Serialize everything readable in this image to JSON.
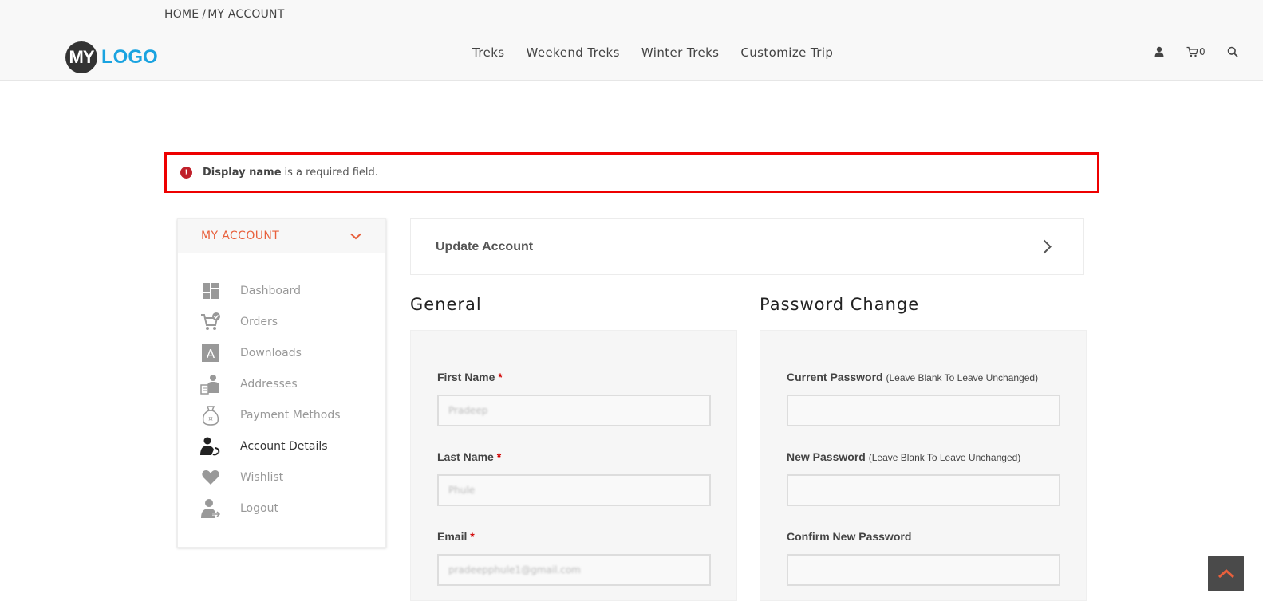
{
  "breadcrumb": {
    "home": "HOME",
    "separator": "/",
    "current": "MY ACCOUNT"
  },
  "logo": {
    "mark": "MY",
    "text": "LOGO",
    "mark_color": "#333333",
    "text_color": "#1aa3e0"
  },
  "nav": {
    "items": [
      "Treks",
      "Weekend Treks",
      "Winter Treks",
      "Customize Trip"
    ]
  },
  "header_icons": {
    "user": "user-icon",
    "cart": "cart-icon",
    "cart_count": "0",
    "search": "search-icon"
  },
  "alert": {
    "field": "Display name",
    "message": "is a required field.",
    "border_color": "#ee0000",
    "icon": "exclamation-circle-icon"
  },
  "sidebar": {
    "title": "MY ACCOUNT",
    "accent": "#e8603c",
    "items": [
      {
        "label": "Dashboard",
        "icon": "dashboard-icon"
      },
      {
        "label": "Orders",
        "icon": "cart-check-icon"
      },
      {
        "label": "Downloads",
        "icon": "download-letter-icon"
      },
      {
        "label": "Addresses",
        "icon": "address-person-icon"
      },
      {
        "label": "Payment Methods",
        "icon": "money-bag-icon"
      },
      {
        "label": "Account Details",
        "icon": "account-user-icon",
        "active": true
      },
      {
        "label": "Wishlist",
        "icon": "heart-icon"
      },
      {
        "label": "Logout",
        "icon": "logout-icon"
      }
    ]
  },
  "update_account": {
    "label": "Update Account"
  },
  "general": {
    "title": "General",
    "first_name": {
      "label": "First Name",
      "required": "*",
      "value": "Pradeep"
    },
    "last_name": {
      "label": "Last Name",
      "required": "*",
      "value": "Phule"
    },
    "email": {
      "label": "Email",
      "required": "*",
      "value": "pradeepphule1@gmail.com"
    }
  },
  "password_change": {
    "title": "Password Change",
    "current": {
      "label": "Current Password",
      "hint": "(Leave Blank To Leave Unchanged)",
      "value": ""
    },
    "new": {
      "label": "New Password",
      "hint": "(Leave Blank To Leave Unchanged)",
      "value": ""
    },
    "confirm": {
      "label": "Confirm New Password",
      "value": ""
    }
  },
  "scroll_top": {
    "icon": "chevron-up-icon",
    "color": "#e8603c"
  }
}
